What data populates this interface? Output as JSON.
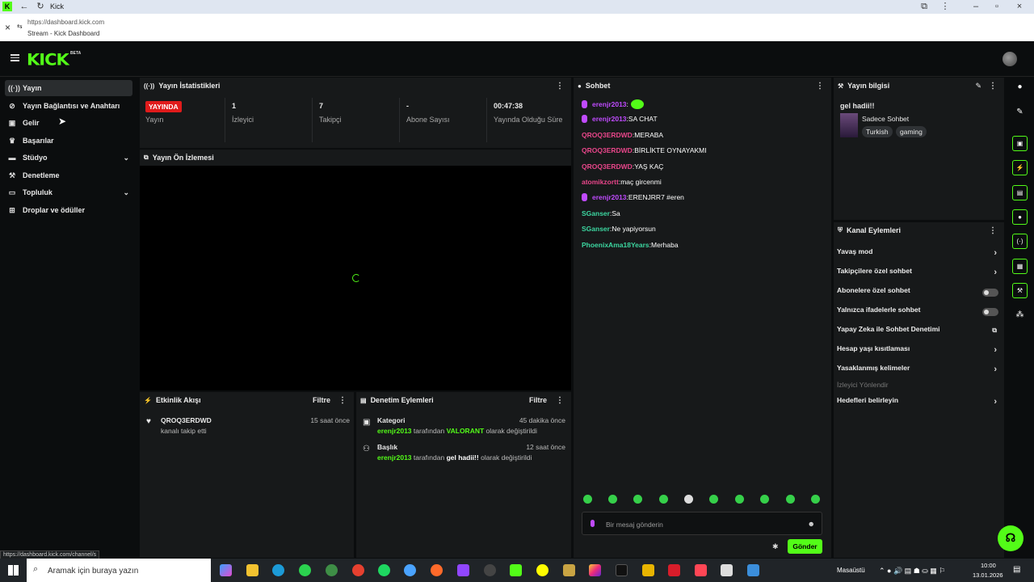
{
  "browser": {
    "tab_title": "Kick",
    "url": "https://dashboard.kick.com",
    "page_title": "Stream - Kick Dashboard",
    "status_url": "https://dashboard.kick.com/channel/s"
  },
  "logo": {
    "text": "KICK",
    "beta": "BETA"
  },
  "sidebar": {
    "items": [
      {
        "label": "Yayın",
        "icon": "broadcast-icon",
        "active": true
      },
      {
        "label": "Yayın Bağlantısı ve Anahtarı",
        "icon": "link-icon"
      },
      {
        "label": "Gelir",
        "icon": "wallet-icon"
      },
      {
        "label": "Başarılar",
        "icon": "trophy-icon"
      },
      {
        "label": "Stüdyo",
        "icon": "studio-icon",
        "expandable": true
      },
      {
        "label": "Denetleme",
        "icon": "wrench-icon"
      },
      {
        "label": "Topluluk",
        "icon": "community-icon",
        "expandable": true
      },
      {
        "label": "Droplar ve ödüller",
        "icon": "gift-icon"
      }
    ]
  },
  "stats": {
    "title": "Yayın İstatistikleri",
    "live_badge": "YAYINDA",
    "live_label": "Yayın",
    "items": [
      {
        "value": "1",
        "label": "İzleyici"
      },
      {
        "value": "7",
        "label": "Takipçi"
      },
      {
        "value": "-",
        "label": "Abone Sayısı"
      },
      {
        "value": "00:47:38",
        "label": "Yayında Olduğu Süre"
      }
    ]
  },
  "preview": {
    "title": "Yayın Ön İzlemesi"
  },
  "activity": {
    "title": "Etkinlik Akışı",
    "filter": "Filtre",
    "items": [
      {
        "user": "QROQ3ERDWD",
        "text": "kanalı takip etti",
        "time": "15 saat önce"
      }
    ]
  },
  "moderation": {
    "title": "Denetim Eylemleri",
    "filter": "Filtre",
    "items": [
      {
        "title": "Kategori",
        "time": "45 dakika önce",
        "actor": "erenjr2013",
        "middle": "tarafından",
        "value": "VALORANT",
        "suffix": "olarak değiştirildi"
      },
      {
        "title": "Başlık",
        "time": "12 saat önce",
        "actor": "erenjr2013",
        "middle": "tarafından",
        "value": "gel hadii!!",
        "suffix": "olarak değiştirildi"
      }
    ]
  },
  "chat": {
    "title": "Sohbet",
    "messages": [
      {
        "user": "erenjr2013",
        "text": "",
        "badge": true,
        "emote": true,
        "color": "#c04bff"
      },
      {
        "user": "erenjr2013",
        "text": "SA CHAT",
        "badge": true,
        "color": "#c04bff"
      },
      {
        "user": "QROQ3ERDWD",
        "text": "MERABA",
        "color": "#e8468a"
      },
      {
        "user": "QROQ3ERDWD",
        "text": "BİRLİKTE OYNAYAKMI",
        "color": "#e8468a"
      },
      {
        "user": "QROQ3ERDWD",
        "text": "YAŞ KAÇ",
        "color": "#e8468a"
      },
      {
        "user": "atomikzortt",
        "text": "maç gircenmi",
        "color": "#e8468a"
      },
      {
        "user": "erenjr2013",
        "text": "ERENJRR7 #eren",
        "badge": true,
        "color": "#c04bff"
      },
      {
        "user": "SGanser",
        "text": "Sa",
        "color": "#3cd6a0"
      },
      {
        "user": "SGanser",
        "text": "Ne yapiyorsun",
        "color": "#3cd6a0"
      },
      {
        "user": "PhoenixAma18Years",
        "text": "Merhaba",
        "color": "#3cd6a0"
      }
    ],
    "input_placeholder": "Bir mesaj gönderin",
    "send_label": "Gönder"
  },
  "stream_info": {
    "title": "Yayın bilgisi",
    "stream_title": "gel hadii!!",
    "category": "Sadece Sohbet",
    "tags": [
      "Turkish",
      "gaming"
    ]
  },
  "channel_actions": {
    "title": "Kanal Eylemleri",
    "items": [
      {
        "label": "Yavaş mod",
        "type": "arrow"
      },
      {
        "label": "Takipçilere özel sohbet",
        "type": "arrow"
      },
      {
        "label": "Abonelere özel sohbet",
        "type": "toggle"
      },
      {
        "label": "Yalnızca ifadelerle sohbet",
        "type": "toggle"
      },
      {
        "label": "Yapay Zeka ile Sohbet Denetimi",
        "type": "external"
      },
      {
        "label": "Hesap yaşı kısıtlaması",
        "type": "arrow"
      },
      {
        "label": "Yasaklanmış kelimeler",
        "type": "arrow"
      },
      {
        "label": "İzleyici Yönlendir",
        "type": "section"
      },
      {
        "label": "Hedefleri belirleyin",
        "type": "arrow"
      }
    ]
  },
  "taskbar": {
    "search_placeholder": "Aramak için buraya yazın",
    "desktop_label": "Masaüstü",
    "time": "10:00",
    "date": "13.01.2026"
  },
  "colors": {
    "accent": "#53fc18",
    "live": "#e01b1b",
    "panel": "#17191a",
    "background": "#0b0d0e"
  }
}
